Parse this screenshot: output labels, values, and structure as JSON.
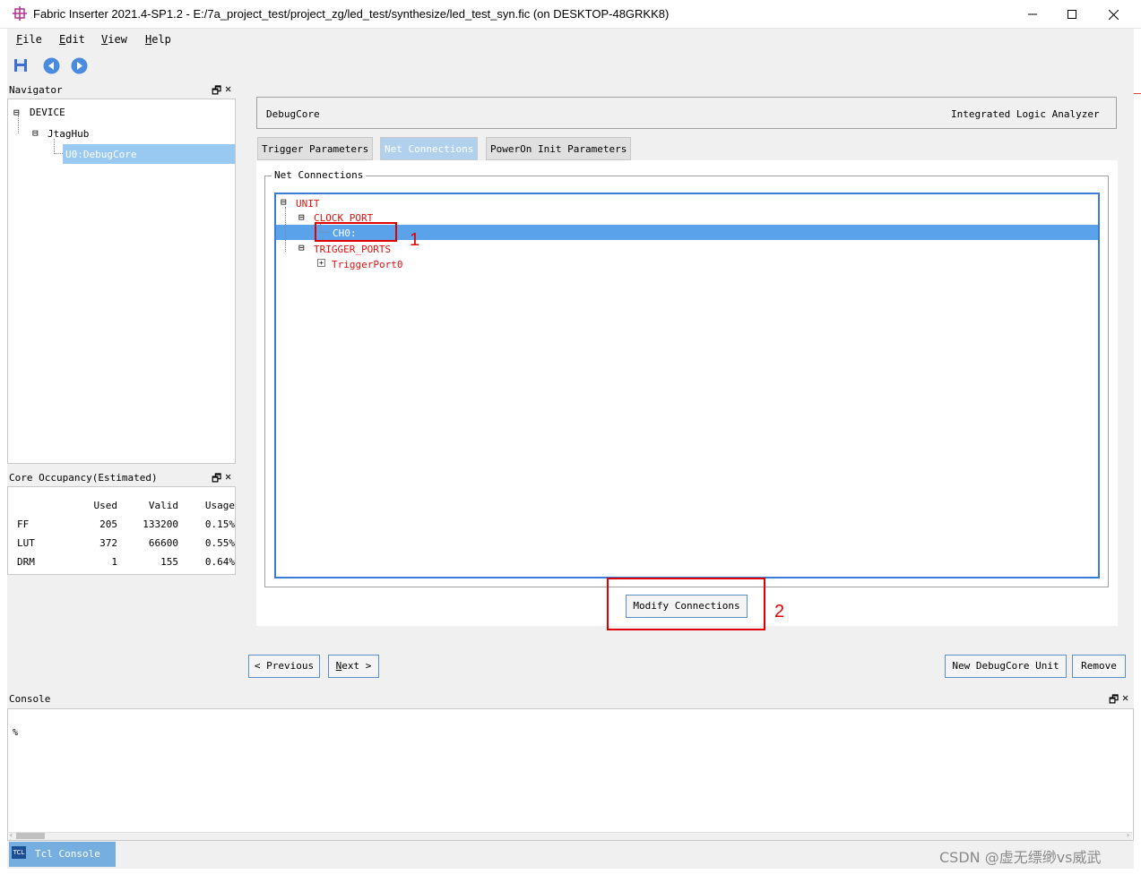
{
  "window": {
    "title": "Fabric Inserter 2021.4-SP1.2 - E:/7a_project_test/project_zg/led_test/synthesize/led_test_syn.fic (on DESKTOP-48GRKK8)",
    "minimize_glyph": "—",
    "maximize_glyph": "☐",
    "close_glyph": "✕"
  },
  "menu": [
    {
      "key": "F",
      "rest": "ile"
    },
    {
      "key": "E",
      "rest": "dit"
    },
    {
      "key": "V",
      "rest": "iew"
    },
    {
      "key": "H",
      "rest": "elp"
    }
  ],
  "toolbar": {
    "icons": [
      "save-icon",
      "back-icon",
      "forward-icon"
    ]
  },
  "navigator": {
    "title": "Navigator",
    "restore_glyph": "🗗",
    "close_glyph": "✕",
    "tree": {
      "device": "DEVICE",
      "hub": "JtagHub",
      "core": "U0:DebugCore"
    },
    "expander": "⊟"
  },
  "occupancy": {
    "title": "Core Occupancy(Estimated)",
    "headers": [
      "",
      "Used",
      "Valid",
      "Usage"
    ],
    "rows": [
      [
        "FF",
        "205",
        "133200",
        "0.15%"
      ],
      [
        "LUT",
        "372",
        "66600",
        "0.55%"
      ],
      [
        "DRM",
        "1",
        "155",
        "0.64%"
      ]
    ]
  },
  "main": {
    "core_label": "DebugCore",
    "core_type": "Integrated Logic Analyzer",
    "tabs": [
      "Trigger Parameters",
      "Net Connections",
      "PowerOn Init Parameters"
    ],
    "active_tab": 1,
    "group_label": "Net Connections",
    "tree": {
      "unit": "UNIT",
      "clock_port": "CLOCK_PORT",
      "ch0": "CH0:",
      "trigger_ports": "TRIGGER_PORTS",
      "trigger_port0": "TriggerPort0"
    },
    "modify_button": "Modify Connections"
  },
  "annotations": {
    "one": "1",
    "two": "2"
  },
  "nav_buttons": {
    "previous": "< Previous",
    "next_key": "N",
    "next_rest": "ext >",
    "new_unit": "New DebugCore Unit",
    "remove": "Remove"
  },
  "console": {
    "title": "Console",
    "prompt": "%",
    "tab_label": "Tcl Console",
    "tab_icon": "TCL"
  },
  "watermark": "CSDN @虚无缥缈vs威武",
  "colors": {
    "accent": "#3a7bd5",
    "selection": "#5aa3ea",
    "tree_red": "#e01010",
    "annotation_red": "#e00000"
  }
}
